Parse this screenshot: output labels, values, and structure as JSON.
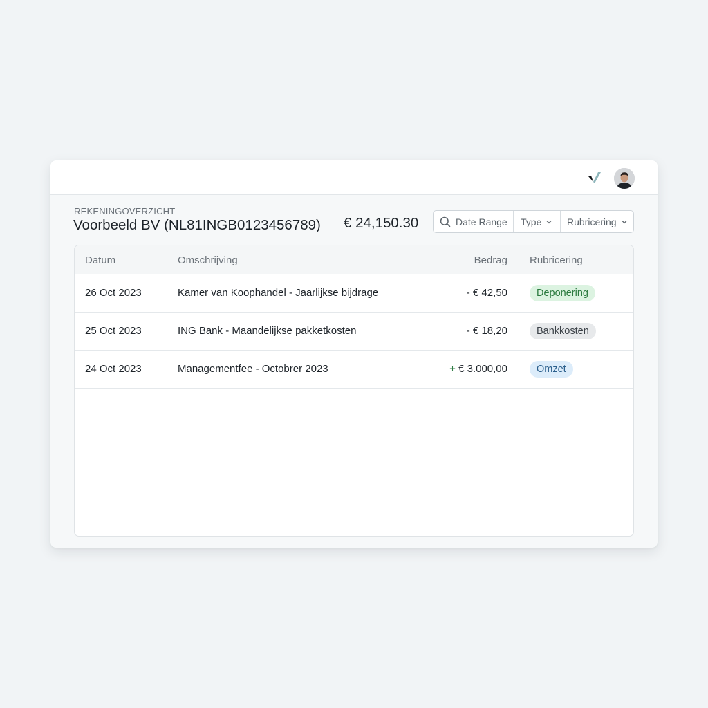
{
  "account": {
    "eyebrow": "REKENINGOVERZICHT",
    "title": "Voorbeeld BV (NL81INGB0123456789)",
    "balance": "€ 24,150.30"
  },
  "filters": {
    "date_range": "Date Range",
    "type": "Type",
    "rubricering": "Rubricering"
  },
  "table": {
    "columns": {
      "date": "Datum",
      "description": "Omschrijving",
      "amount": "Bedrag",
      "category": "Rubricering"
    },
    "rows": [
      {
        "date": "26 Oct 2023",
        "description": "Kamer van Koophandel - Jaarlijkse bijdrage",
        "sign": "-",
        "amount": "€ 42,50",
        "category": "Deponering"
      },
      {
        "date": "25 Oct 2023",
        "description": "ING Bank - Maandelijkse pakketkosten",
        "sign": "-",
        "amount": "€ 18,20",
        "category": "Bankkosten"
      },
      {
        "date": "24 Oct 2023",
        "description": "Managementfee - Octobrer 2023",
        "sign": "+",
        "amount": "€ 3.000,00",
        "category": "Omzet"
      }
    ]
  },
  "badge_colors": {
    "Deponering": {
      "bg": "#dcf3e1",
      "fg": "#2b7a3f"
    },
    "Bankkosten": {
      "bg": "#e7e9eb",
      "fg": "#3c4248"
    },
    "Omzet": {
      "bg": "#dcecfa",
      "fg": "#2b5f8c"
    }
  },
  "icons": {
    "logo": "checkmark-logo-icon",
    "search": "search-icon",
    "chevron": "chevron-down-icon"
  }
}
